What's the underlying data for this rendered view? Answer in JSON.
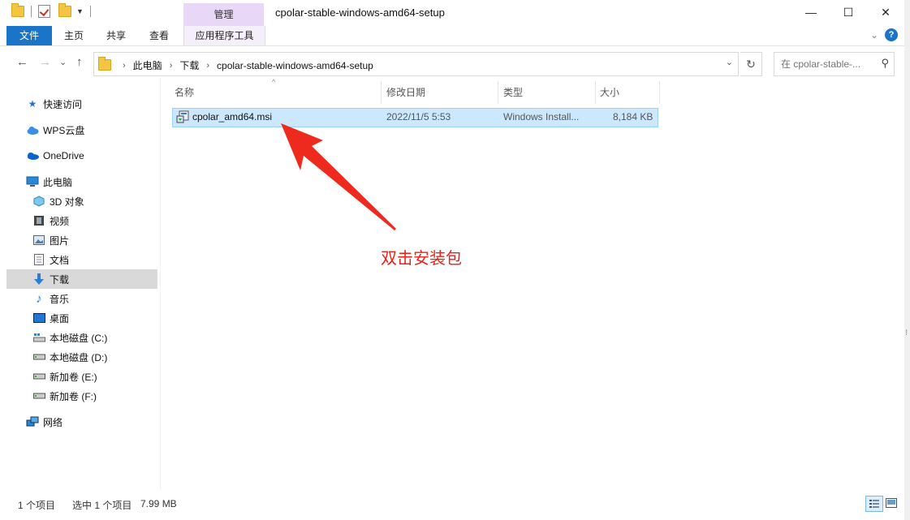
{
  "titlebar": {
    "manage_tab": "管理",
    "title": "cpolar-stable-windows-amd64-setup",
    "minimize": "—",
    "maximize": "☐",
    "close": "✕"
  },
  "ribbon": {
    "tabs": [
      "文件",
      "主页",
      "共享",
      "查看",
      "应用程序工具"
    ],
    "help": "?"
  },
  "nav": {
    "back": "←",
    "forward": "→",
    "recent": "⌄",
    "up": "↑",
    "breadcrumbs": [
      "此电脑",
      "下载",
      "cpolar-stable-windows-amd64-setup"
    ],
    "search_placeholder": "在 cpolar-stable-..."
  },
  "sidebar": {
    "items": [
      {
        "label": "快速访问",
        "icon": "star-icon"
      },
      {
        "label": "WPS云盘",
        "icon": "wps-cloud-icon"
      },
      {
        "label": "OneDrive",
        "icon": "onedrive-icon"
      },
      {
        "label": "此电脑",
        "icon": "computer-icon"
      },
      {
        "label": "3D 对象",
        "icon": "3d-objects-icon"
      },
      {
        "label": "视频",
        "icon": "video-icon"
      },
      {
        "label": "图片",
        "icon": "pictures-icon"
      },
      {
        "label": "文档",
        "icon": "documents-icon"
      },
      {
        "label": "下载",
        "icon": "download-icon"
      },
      {
        "label": "音乐",
        "icon": "music-icon"
      },
      {
        "label": "桌面",
        "icon": "desktop-icon"
      },
      {
        "label": "本地磁盘 (C:)",
        "icon": "drive-c-icon"
      },
      {
        "label": "本地磁盘 (D:)",
        "icon": "drive-icon"
      },
      {
        "label": "新加卷 (E:)",
        "icon": "drive-icon"
      },
      {
        "label": "新加卷 (F:)",
        "icon": "drive-icon"
      },
      {
        "label": "网络",
        "icon": "network-icon"
      }
    ]
  },
  "filelist": {
    "columns": [
      "名称",
      "修改日期",
      "类型",
      "大小"
    ],
    "rows": [
      {
        "name": "cpolar_amd64.msi",
        "modified": "2022/11/5 5:53",
        "type": "Windows Install...",
        "size": "8,184 KB"
      }
    ]
  },
  "annotation": {
    "text": "双击安装包",
    "color": "#e8201a"
  },
  "status": {
    "count": "1 个项目",
    "selected": "选中 1 个项目",
    "size": "7.99 MB"
  },
  "colors": {
    "accent": "#1a74c8",
    "manage_tab": "#e8d7f6",
    "selection": "#cce8ff"
  }
}
